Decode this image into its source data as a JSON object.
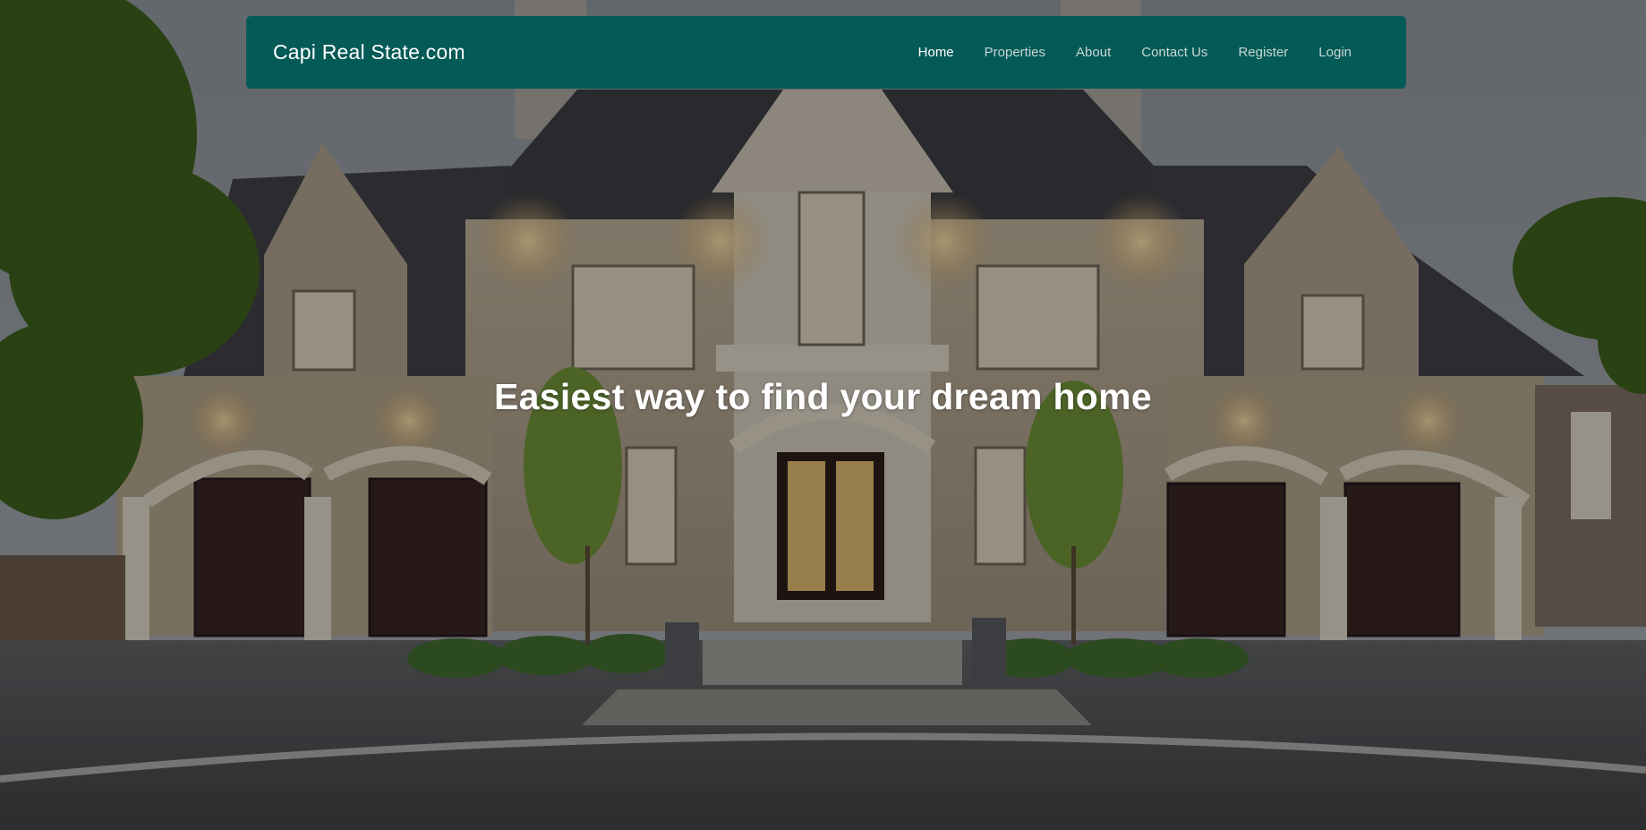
{
  "colors": {
    "navbar_bg": "#045a57",
    "nav_text": "#c8d6d4",
    "nav_active_text": "#ffffff",
    "headline_text": "#ffffff",
    "overlay": "rgba(0,0,0,0.30)"
  },
  "navbar": {
    "brand": "Capi Real State.com",
    "links": [
      {
        "label": "Home",
        "active": true
      },
      {
        "label": "Properties",
        "active": false
      },
      {
        "label": "About",
        "active": false
      },
      {
        "label": "Contact Us",
        "active": false
      },
      {
        "label": "Register",
        "active": false
      },
      {
        "label": "Login",
        "active": false
      }
    ]
  },
  "hero": {
    "headline": "Easiest way to find your dream home",
    "background": "luxury-stone-house-photo"
  }
}
